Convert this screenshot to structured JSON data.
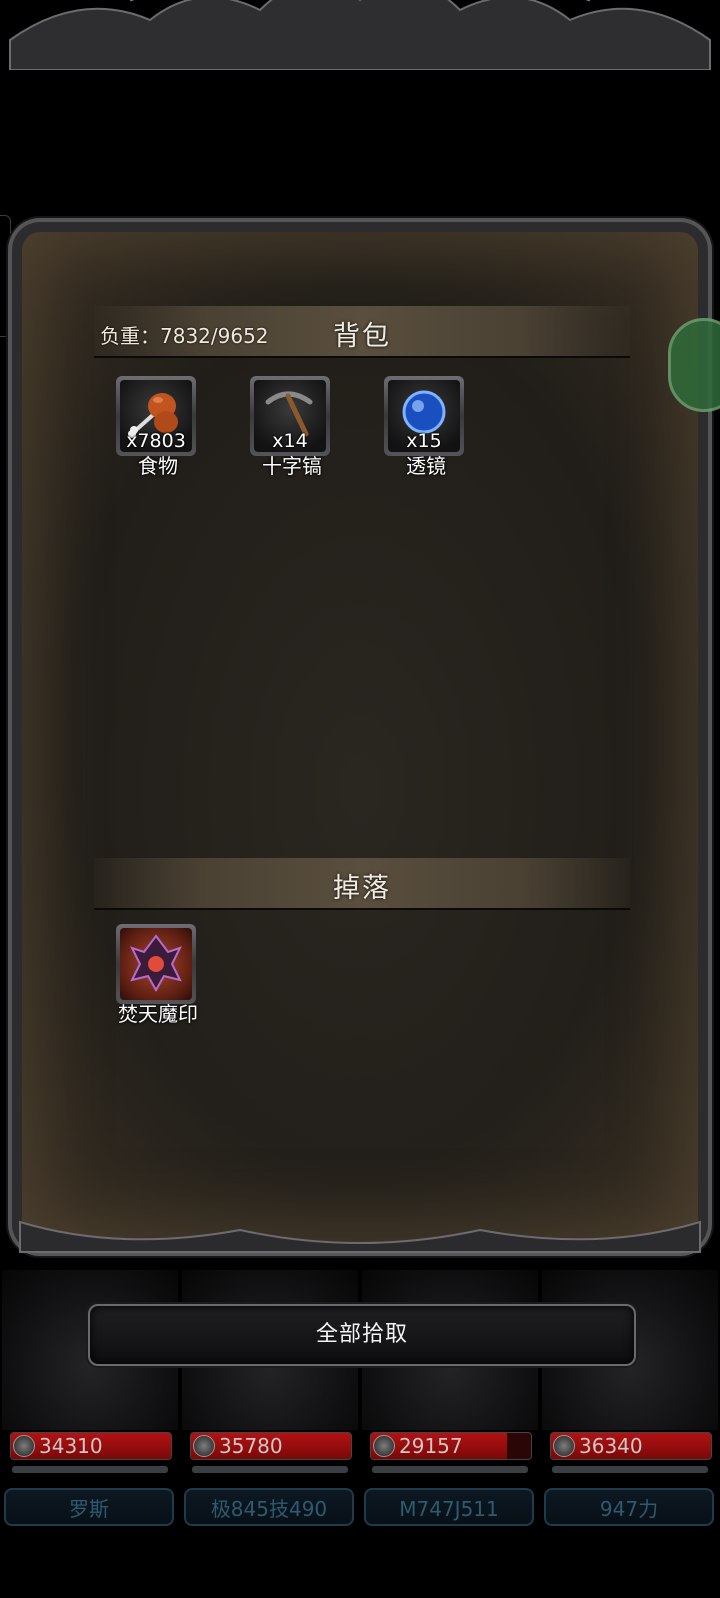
{
  "backpack": {
    "title": "背包",
    "weight_label": "负重：7832/9652",
    "items": [
      {
        "name": "食物",
        "count": "x7803",
        "icon": "drumstick-icon"
      },
      {
        "name": "十字镐",
        "count": "x14",
        "icon": "pickaxe-icon"
      },
      {
        "name": "透镜",
        "count": "x15",
        "icon": "lens-icon"
      }
    ]
  },
  "drops": {
    "title": "掉落",
    "items": [
      {
        "name": "焚天魔印",
        "icon": "demon-seal-icon"
      }
    ]
  },
  "pickup_all_label": "全部拾取",
  "team": [
    {
      "hp": "34310",
      "hp_fraction": 1.0,
      "name": "罗斯"
    },
    {
      "hp": "35780",
      "hp_fraction": 1.0,
      "name": "极845技490"
    },
    {
      "hp": "29157",
      "hp_fraction": 0.85,
      "name": "M747J511"
    },
    {
      "hp": "36340",
      "hp_fraction": 1.0,
      "name": "947力"
    }
  ],
  "colors": {
    "hp_red": "#b31212",
    "panel_bg": "#221f1a",
    "nameplate_text": "#2d5a70"
  }
}
